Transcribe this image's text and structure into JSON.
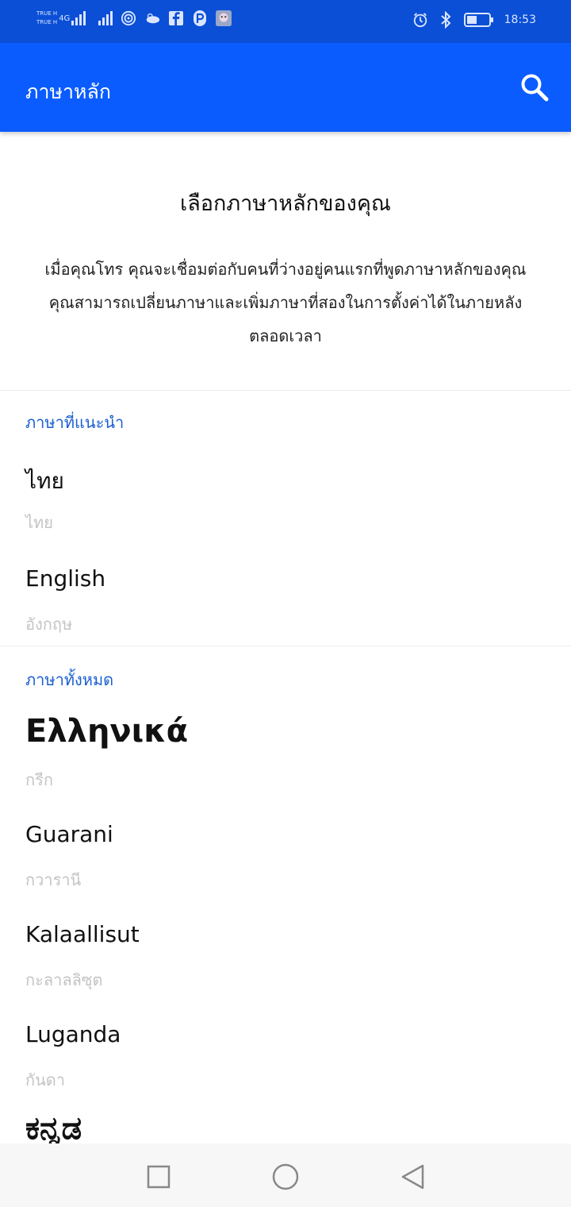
{
  "status_bar": {
    "carrier_top": "TRUE H",
    "carrier_bottom": "TRUE H",
    "network": "4G",
    "time": "18:53",
    "icons": [
      "signal-icon",
      "wifi-icon",
      "weather-icon",
      "facebook-icon",
      "app-icon",
      "avatar-icon",
      "alarm-icon",
      "bluetooth-icon",
      "battery-icon"
    ]
  },
  "app_bar": {
    "title": "ภาษาหลัก",
    "search_icon": "search-icon",
    "color": "#0a5cff"
  },
  "intro": {
    "title": "เลือกภาษาหลักของคุณ",
    "description": "เมื่อคุณโทร คุณจะเชื่อมต่อกับคนที่ว่างอยู่คนแรกที่พูดภาษาหลักของคุณ คุณสามารถเปลี่ยนภาษาและเพิ่มภาษาที่สองในการตั้งค่าได้ในภายหลังตลอดเวลา"
  },
  "suggested": {
    "label": "ภาษาที่แนะนำ",
    "items": [
      {
        "name": "ไทย",
        "sub": "ไทย"
      },
      {
        "name": "English",
        "sub": "อังกฤษ"
      }
    ]
  },
  "all_languages": {
    "label": "ภาษาทั้งหมด",
    "items": [
      {
        "name": "Ελληνικά",
        "sub": "กรีก"
      },
      {
        "name": "Guarani",
        "sub": "กวารานี"
      },
      {
        "name": "Kalaallisut",
        "sub": "กะลาลลิซุต"
      },
      {
        "name": "Luganda",
        "sub": "กันดา"
      },
      {
        "name": "ಕನ್ನಡ",
        "sub": ""
      }
    ]
  },
  "nav_bar": {
    "icons": [
      "recent-apps-icon",
      "home-icon",
      "back-icon"
    ]
  }
}
